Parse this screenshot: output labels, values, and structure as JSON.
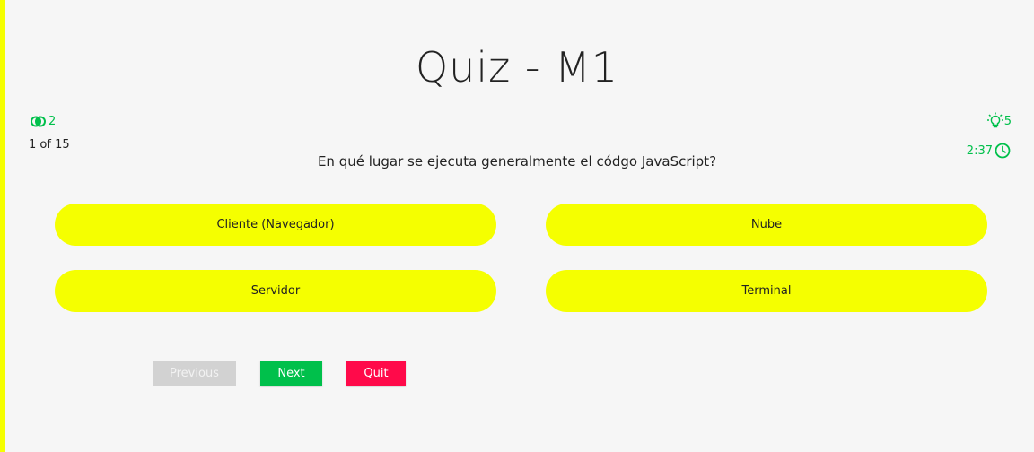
{
  "quiz": {
    "title": "Quiz - M1",
    "lifelines_count": "2",
    "lifelines_icon": "fifty-fifty-icon",
    "progress": "1 of 15",
    "hints_count": "5",
    "hints_icon": "lightbulb-icon",
    "timer": "2:37",
    "timer_icon": "clock-icon",
    "question": "En qué lugar se ejecuta generalmente el códgo JavaScript?",
    "options": [
      "Cliente (Navegador)",
      "Nube",
      "Servidor",
      "Terminal"
    ]
  },
  "controls": {
    "previous_label": "Previous",
    "next_label": "Next",
    "quit_label": "Quit"
  },
  "colors": {
    "accent": "#00c04b",
    "option_bg": "#f5ff00",
    "quit": "#ff0a4a",
    "disabled": "#d2d2d2",
    "background": "#f6f6f6"
  }
}
